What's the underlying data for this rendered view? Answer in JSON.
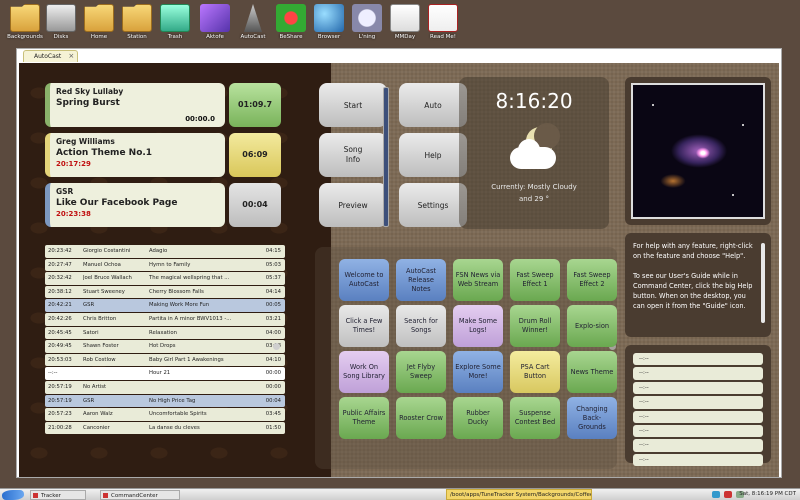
{
  "desktop": {
    "icons": [
      {
        "label": "Backgrounds",
        "icon": "folder-icon"
      },
      {
        "label": "Disks",
        "icon": "disks-icon"
      },
      {
        "label": "Home",
        "icon": "home-folder-icon"
      },
      {
        "label": "Station",
        "icon": "station-folder-icon"
      },
      {
        "label": "Trash",
        "icon": "trash-icon"
      },
      {
        "label": "Aktofe",
        "icon": "pen-icon"
      },
      {
        "label": "AutoCast",
        "icon": "antenna-icon"
      },
      {
        "label": "BeShare",
        "icon": "flower-icon"
      },
      {
        "label": "Browser",
        "icon": "globe-icon"
      },
      {
        "label": "L'ning",
        "icon": "magnifier-icon"
      },
      {
        "label": "MMDay",
        "icon": "document-icon"
      },
      {
        "label": "Read Me!",
        "icon": "pdf-icon"
      }
    ]
  },
  "window": {
    "tab_label": "AutoCast",
    "close_glyph": "×"
  },
  "now_playing": [
    {
      "artist": "Red Sky Lullaby",
      "title": "Spring Burst",
      "time": "00:00.0",
      "countdown": "01:09.7",
      "state": "playing"
    },
    {
      "artist": "Greg Williams",
      "title": "Action Theme No.1",
      "time": "20:17:29",
      "countdown": "06:09",
      "state": "next"
    },
    {
      "artist": "GSR",
      "title": "Like Our Facebook Page",
      "time": "20:23:38",
      "countdown": "00:04",
      "state": "queued"
    }
  ],
  "log": [
    {
      "time": "20:23:42",
      "artist": "Giorgio Costantini",
      "title": "Adagio",
      "len": "04:15",
      "style": "normal"
    },
    {
      "time": "20:27:47",
      "artist": "Manuel Ochoa",
      "title": "Hymn to Family",
      "len": "05:03",
      "style": "normal"
    },
    {
      "time": "20:32:42",
      "artist": "Joel Bruce Wallach",
      "title": "The magical wellspring that ...",
      "len": "05:37",
      "style": "normal"
    },
    {
      "time": "20:38:12",
      "artist": "Stuart Sweeney",
      "title": "Cherry Blossom Falls",
      "len": "04:14",
      "style": "normal"
    },
    {
      "time": "20:42:21",
      "artist": "GSR",
      "title": "Making Work More Fun",
      "len": "00:05",
      "style": "blue"
    },
    {
      "time": "20:42:26",
      "artist": "Chris Britton",
      "title": "Partita in A minor BWV1013 -...",
      "len": "03:21",
      "style": "normal"
    },
    {
      "time": "20:45:45",
      "artist": "Satori",
      "title": "Relaxation",
      "len": "04:00",
      "style": "normal"
    },
    {
      "time": "20:49:45",
      "artist": "Shawn Foster",
      "title": "Hot Drops",
      "len": "03:18",
      "style": "normal"
    },
    {
      "time": "20:53:03",
      "artist": "Rob Costlow",
      "title": "Baby Girl Part 1 Awakenings",
      "len": "04:10",
      "style": "normal"
    },
    {
      "time": "--:--",
      "artist": "",
      "title": "Hour 21",
      "len": "00:00",
      "style": "hour"
    },
    {
      "time": "20:57:19",
      "artist": "No Artist",
      "title": "",
      "len": "00:00",
      "style": "normal"
    },
    {
      "time": "20:57:19",
      "artist": "GSR",
      "title": "No High Price Tag",
      "len": "00:04",
      "style": "blue"
    },
    {
      "time": "20:57:23",
      "artist": "Aaron Walz",
      "title": "Uncomfortable Spirits",
      "len": "03:45",
      "style": "normal"
    },
    {
      "time": "21:00:28",
      "artist": "Canconier",
      "title": "La danse du cleves",
      "len": "01:50",
      "style": "normal"
    }
  ],
  "controls": {
    "start": "Start",
    "auto": "Auto",
    "song_info": "Song\nInfo",
    "help": "Help",
    "preview": "Preview",
    "settings": "Settings"
  },
  "clock": {
    "time": "8:16:20",
    "weather_line1": "Currently: Mostly Cloudy",
    "weather_line2": "and 29 °",
    "icon": "moon-cloud-icon"
  },
  "help": {
    "p1": "For help with any feature, right-click on the feature and choose \"Help\".",
    "p2": "To see our User's Guide while in Command Center, click the big Help button. When on the desktop, you can open it from the \"Guide\" icon."
  },
  "slots": [
    "--:--",
    "--:--",
    "--:--",
    "--:--",
    "--:--",
    "--:--",
    "--:--",
    "--:--"
  ],
  "grid_buttons": [
    {
      "label": "Welcome to AutoCast",
      "color": "blue"
    },
    {
      "label": "AutoCast Release Notes",
      "color": "blue"
    },
    {
      "label": "FSN News via Web Stream",
      "color": "green"
    },
    {
      "label": "Fast Sweep Effect 1",
      "color": "green"
    },
    {
      "label": "Fast Sweep Effect 2",
      "color": "green"
    },
    {
      "label": "Click a Few Times!",
      "color": "gray"
    },
    {
      "label": "Search for Songs",
      "color": "gray"
    },
    {
      "label": "Make Some Logs!",
      "color": "purple"
    },
    {
      "label": "Drum Roll Winner!",
      "color": "green"
    },
    {
      "label": "Explo-sion",
      "color": "green"
    },
    {
      "label": "Work On Song Library",
      "color": "purple"
    },
    {
      "label": "Jet Flyby Sweep",
      "color": "green"
    },
    {
      "label": "Explore Some More!",
      "color": "blue"
    },
    {
      "label": "PSA Cart Button",
      "color": "yellow"
    },
    {
      "label": "News Theme",
      "color": "green"
    },
    {
      "label": "Public Affairs Theme",
      "color": "green"
    },
    {
      "label": "Rooster Crow",
      "color": "green"
    },
    {
      "label": "Rubber Ducky",
      "color": "green"
    },
    {
      "label": "Suspense Contest Bed",
      "color": "green"
    },
    {
      "label": "Changing Back-Grounds",
      "color": "blue"
    }
  ],
  "taskbar": {
    "items": [
      {
        "label": "Tracker"
      },
      {
        "label": "CommandCenter"
      }
    ],
    "path": "/boot/apps/TuneTracker System/Backgrounds/Coffee",
    "clock": "Sat, 8:16:19 PM CDT"
  }
}
